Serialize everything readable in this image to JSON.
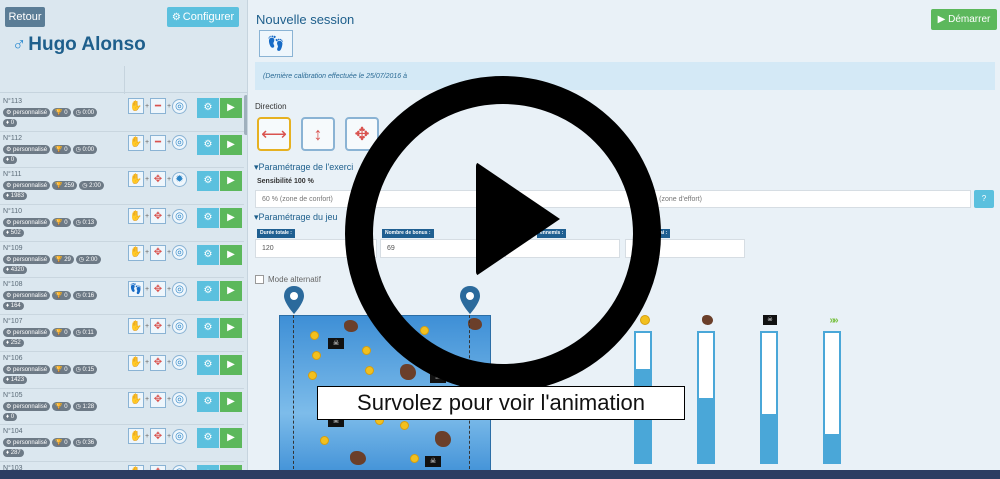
{
  "sidebar": {
    "back_label": "Retour",
    "config_label": "Configurer",
    "user_symbol": "♂",
    "user_name": "Hugo Alonso",
    "items": [
      {
        "no": "N°113",
        "b1": "personnalisé",
        "b2": "0",
        "b3": "0:00",
        "b4": "0"
      },
      {
        "no": "N°112",
        "b1": "personnalisé",
        "b2": "0",
        "b3": "0:00",
        "b4": "0"
      },
      {
        "no": "N°111",
        "b1": "personnalisé",
        "b2": "259",
        "b3": "2:00",
        "b4": "1983"
      },
      {
        "no": "N°110",
        "b1": "personnalisé",
        "b2": "0",
        "b3": "0:13",
        "b4": "502"
      },
      {
        "no": "N°109",
        "b1": "personnalisé",
        "b2": "29",
        "b3": "2:00",
        "b4": "4320"
      },
      {
        "no": "N°108",
        "b1": "personnalisé",
        "b2": "0",
        "b3": "0:16",
        "b4": "164"
      },
      {
        "no": "N°107",
        "b1": "personnalisé",
        "b2": "0",
        "b3": "0:11",
        "b4": "252"
      },
      {
        "no": "N°106",
        "b1": "personnalisé",
        "b2": "0",
        "b3": "0:15",
        "b4": "1423"
      },
      {
        "no": "N°105",
        "b1": "personnalisé",
        "b2": "0",
        "b3": "1:28",
        "b4": "0"
      },
      {
        "no": "N°104",
        "b1": "personnalisé",
        "b2": "0",
        "b3": "0:36",
        "b4": "287"
      },
      {
        "no": "N°103",
        "b1": "",
        "b2": "",
        "b3": "",
        "b4": ""
      }
    ]
  },
  "main": {
    "title": "Nouvelle session",
    "start_label": "Démarrer",
    "calibration_text": "(Dernière calibration effectuée le 25/07/2016 à",
    "direction_label": "Direction",
    "exercise_section": "▾Paramétrage de l'exerci",
    "sensitivity_label": "Sensibilité 100 %",
    "sensitivity_left": "60 % (zone de confort)",
    "sensitivity_right": "% (zone d'effort)",
    "help_label": "?",
    "game_section": "▾Paramétrage du jeu",
    "game_fields": [
      {
        "label": "Durée totale :",
        "value": "120"
      },
      {
        "label": "Nombre de bonus :",
        "value": "69"
      },
      {
        "label": "ennemis :",
        "value": ""
      },
      {
        "label": "ai :",
        "value": ""
      }
    ],
    "mode_label": "Mode alternatif"
  },
  "bars": [
    {
      "icon": "coin-icon",
      "fill": 0.72
    },
    {
      "icon": "rock-icon",
      "fill": 0.5
    },
    {
      "icon": "pirate-flag-icon",
      "fill": 0.37
    },
    {
      "icon": "chevrons-icon",
      "fill": 0.22
    }
  ],
  "overlay": {
    "hover_text": "Survolez pour voir l'animation"
  },
  "colors": {
    "accent_blue": "#1e5f8c",
    "info": "#5bc0de",
    "success": "#5cb85c",
    "selected_border": "#e6b121"
  }
}
